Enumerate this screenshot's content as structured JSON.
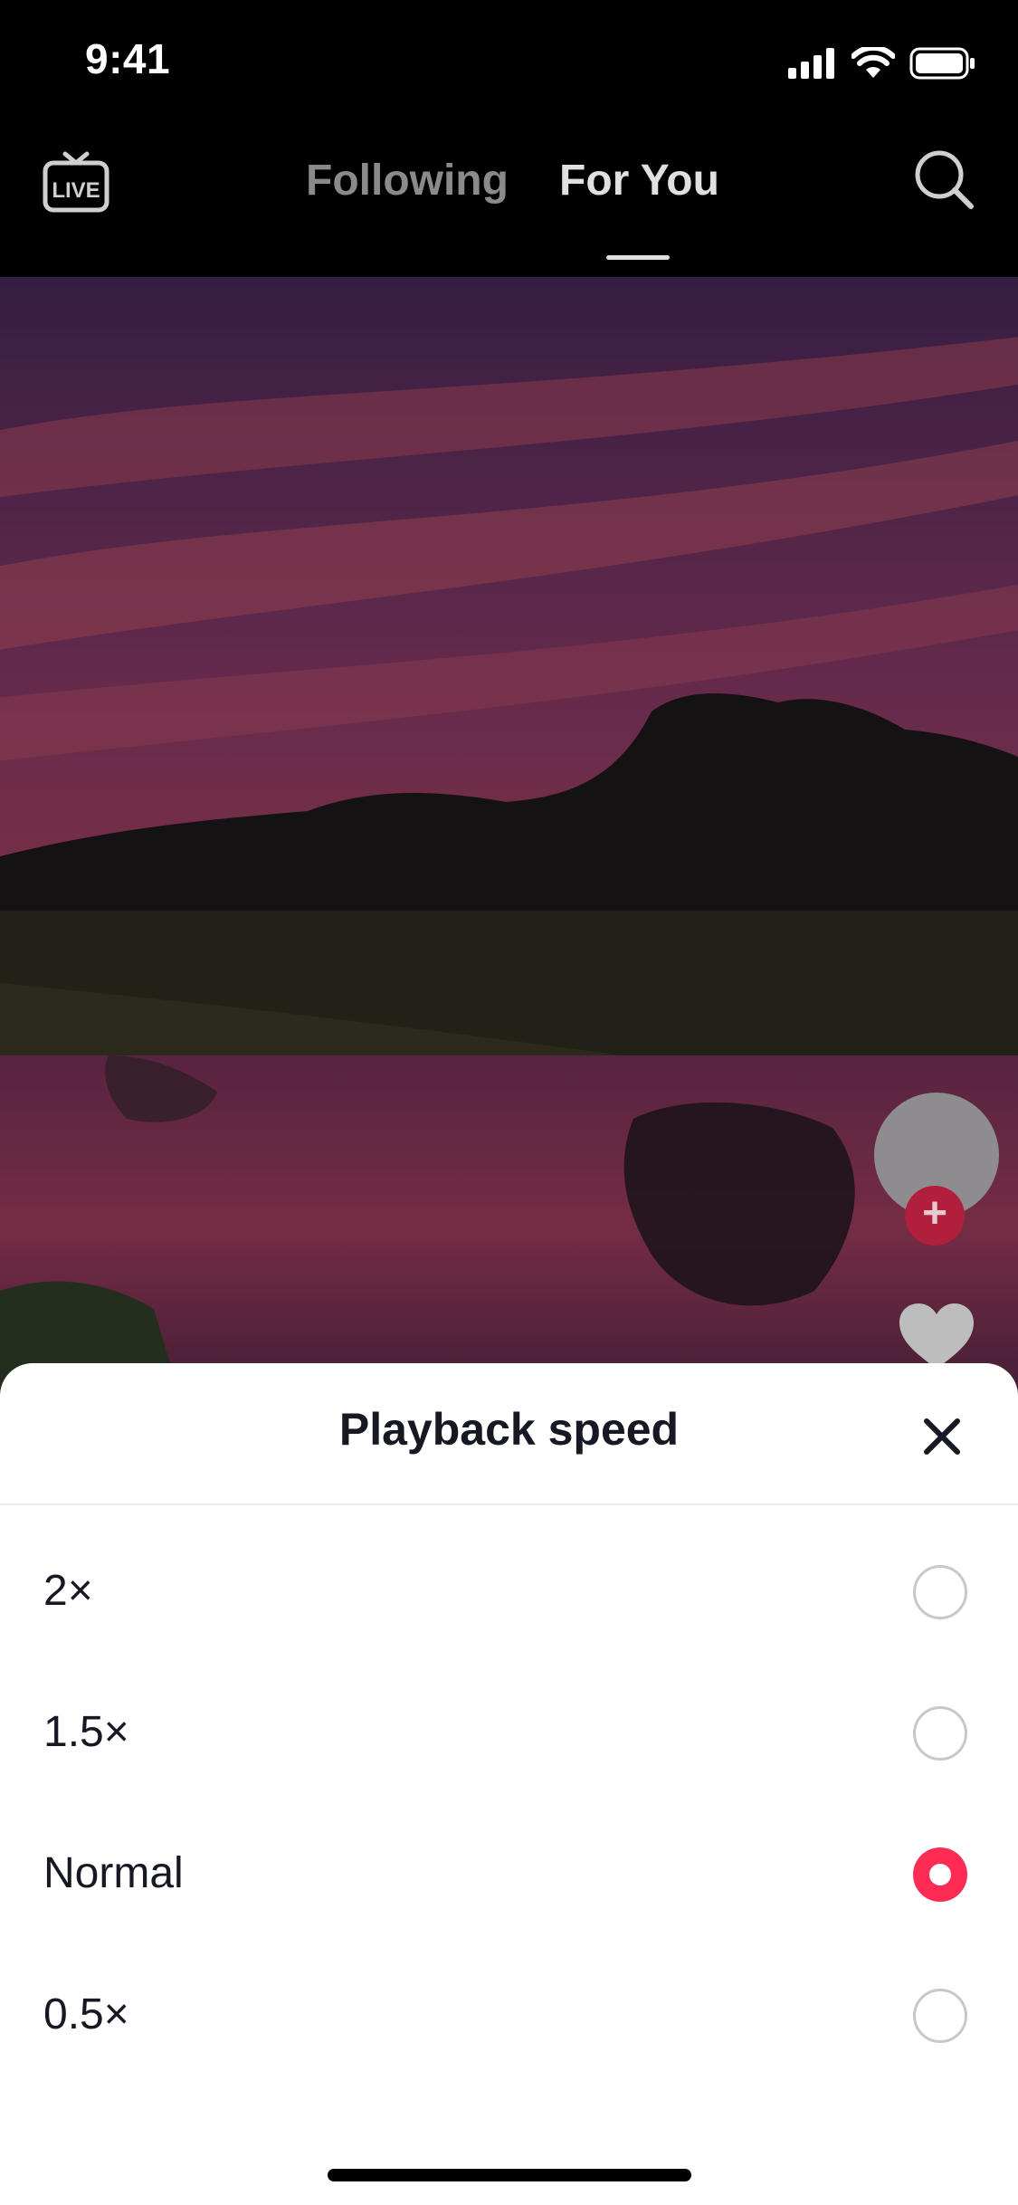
{
  "status_bar": {
    "time": "9:41"
  },
  "top_nav": {
    "live_icon": "live-tv-icon",
    "live_label": "LIVE",
    "tabs": [
      {
        "label": "Following",
        "active": false
      },
      {
        "label": "For You",
        "active": true
      }
    ],
    "search_icon": "search-icon"
  },
  "side_actions": {
    "follow_icon": "plus-icon",
    "follow_label": "+",
    "like_icon": "heart-icon"
  },
  "sheet": {
    "title": "Playback speed",
    "close_icon": "close-icon",
    "options": [
      {
        "label": "2×",
        "selected": false
      },
      {
        "label": "1.5×",
        "selected": false
      },
      {
        "label": "Normal",
        "selected": true
      },
      {
        "label": "0.5×",
        "selected": false
      }
    ]
  },
  "colors": {
    "accent": "#FE2C55",
    "background": "#000000",
    "sheet_background": "#FFFFFF",
    "text_primary": "#161823",
    "tab_inactive": "#8A8A8A"
  }
}
